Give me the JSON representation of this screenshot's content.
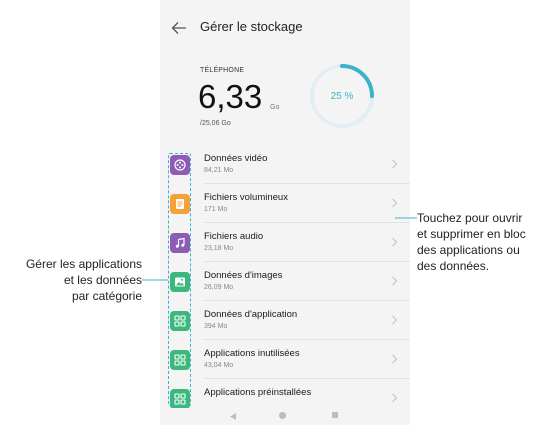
{
  "header": {
    "title": "Gérer le stockage"
  },
  "storage": {
    "label": "TÉLÉPHONE",
    "used_value": "6,33",
    "used_unit": "Go",
    "total": "/25,06 Go",
    "percent_text": "25 %",
    "percent": 25
  },
  "categories": [
    {
      "name": "Données vidéo",
      "size": "84,21 Mo",
      "icon": "video-icon",
      "color": "#8e5bb5"
    },
    {
      "name": "Fichiers volumineux",
      "size": "171 Mo",
      "icon": "document-icon",
      "color": "#f4a13a"
    },
    {
      "name": "Fichiers audio",
      "size": "23,18 Mo",
      "icon": "music-icon",
      "color": "#8e5bb5"
    },
    {
      "name": "Données d'images",
      "size": "26,09 Mo",
      "icon": "image-icon",
      "color": "#3db87d"
    },
    {
      "name": "Données d'application",
      "size": "394 Mo",
      "icon": "app-grid-icon",
      "color": "#3db87d"
    },
    {
      "name": "Applications inutilisées",
      "size": "43,04 Mo",
      "icon": "app-grid-icon",
      "color": "#3db87d"
    },
    {
      "name": "Applications préinstallées",
      "size": "",
      "icon": "app-grid-icon",
      "color": "#3db87d"
    }
  ],
  "annotations": {
    "left": [
      "Gérer les applications",
      "et les données",
      "par catégorie"
    ],
    "right": [
      "Touchez pour ouvrir",
      "et supprimer en bloc",
      "des applications ou",
      "des données."
    ]
  },
  "colors": {
    "accent": "#3bb3c9",
    "ring_track": "#e3eef2"
  }
}
